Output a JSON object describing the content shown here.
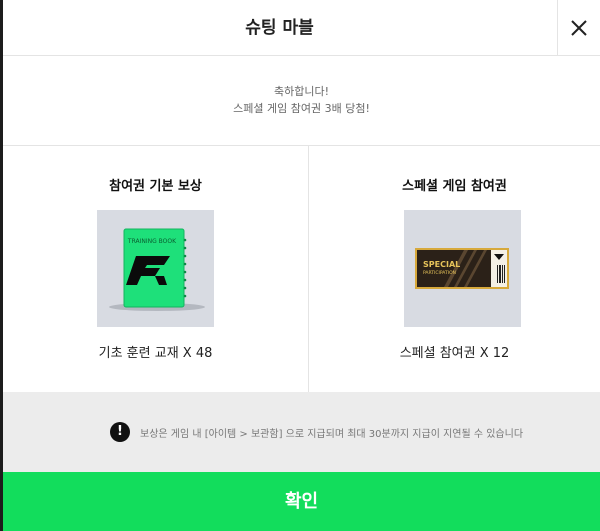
{
  "header": {
    "title": "슈팅 마블",
    "close_icon": "close-icon"
  },
  "message": {
    "line1": "축하합니다!",
    "line2": "스페셜 게임 참여권 3배 당첨!"
  },
  "rewards": [
    {
      "title": "참여권 기본 보상",
      "label": "기초 훈련 교재 X 48",
      "image": "training-book",
      "image_text": "TRAINING BOOK"
    },
    {
      "title": "스페셜 게임 참여권",
      "label": "스페셜 참여권 X 12",
      "image": "special-ticket",
      "image_text_1": "SPECIAL",
      "image_text_2": "PARTICIPATION"
    }
  ],
  "notice": {
    "icon": "exclamation-icon",
    "text": "보상은 게임 내 [아이템 > 보관함] 으로 지급되며 최대 30분까지 지급이 지연될 수 있습니다"
  },
  "confirm_label": "확인",
  "colors": {
    "accent": "#12dd5c",
    "book": "#1ee07a",
    "ticket_gold": "#d7a93c"
  }
}
